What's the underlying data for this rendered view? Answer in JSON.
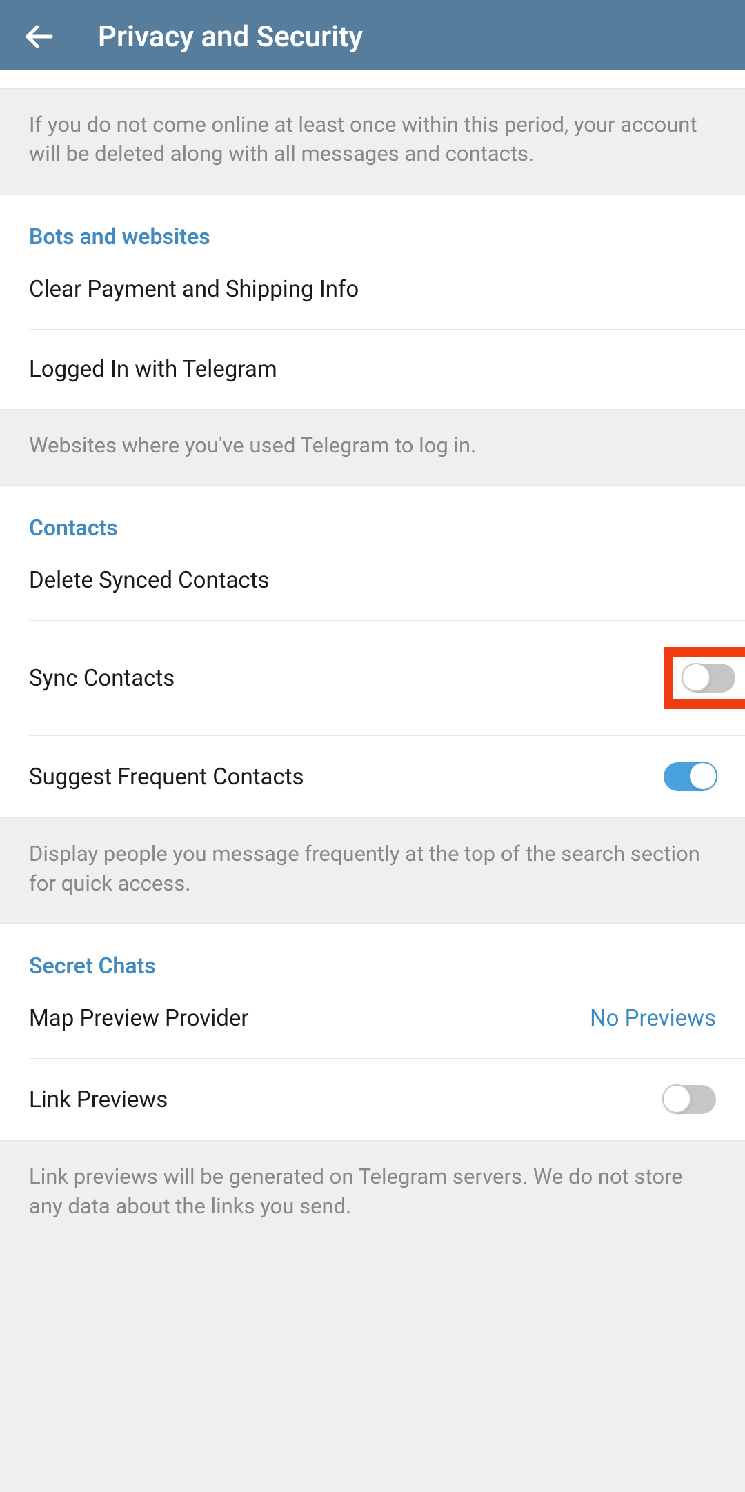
{
  "header": {
    "title": "Privacy and Security"
  },
  "account_deletion": {
    "info": "If you do not come online at least once within this period, your account will be deleted along with all messages and contacts."
  },
  "bots_websites": {
    "title": "Bots and websites",
    "clear_payment": "Clear Payment and Shipping Info",
    "logged_in": "Logged In with Telegram",
    "info": "Websites where you've used Telegram to log in."
  },
  "contacts": {
    "title": "Contacts",
    "delete_synced": "Delete Synced Contacts",
    "sync_contacts": "Sync Contacts",
    "suggest_frequent": "Suggest Frequent Contacts",
    "info": "Display people you message frequently at the top of the search section for quick access."
  },
  "secret_chats": {
    "title": "Secret Chats",
    "map_preview": "Map Preview Provider",
    "map_preview_value": "No Previews",
    "link_previews": "Link Previews",
    "info": "Link previews will be generated on Telegram servers. We do not store any data about the links you send."
  }
}
